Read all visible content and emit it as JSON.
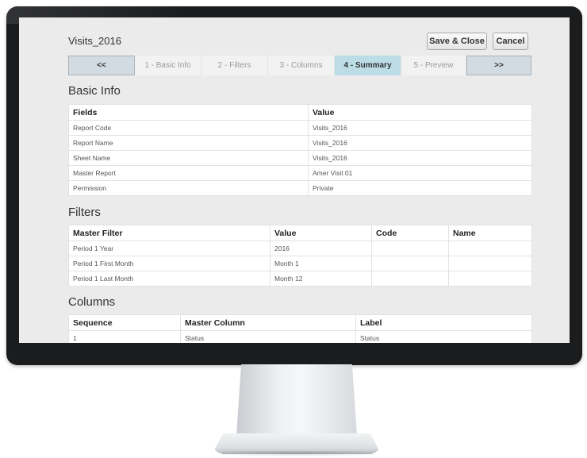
{
  "report": {
    "title": "Visits_2016",
    "save_close_label": "Save & Close",
    "cancel_label": "Cancel"
  },
  "wizard": {
    "prev_label": "<<",
    "next_label": ">>",
    "steps": [
      "1 - Basic Info",
      "2 - Filters",
      "3 - Columns",
      "4 - Summary",
      "5 - Preview"
    ],
    "active_step": "4 - Summary"
  },
  "basic_info": {
    "title": "Basic Info",
    "headers": [
      "Fields",
      "Value"
    ],
    "rows": [
      [
        "Report Code",
        "Visits_2016"
      ],
      [
        "Report Name",
        "Visits_2016"
      ],
      [
        "Sheet Name",
        "Visits_2016"
      ],
      [
        "Master Report",
        "Amer Visit 01"
      ],
      [
        "Permission",
        "Private"
      ]
    ]
  },
  "filters": {
    "title": "Filters",
    "headers": [
      "Master Filter",
      "Value",
      "Code",
      "Name"
    ],
    "rows": [
      [
        "Period 1 Year",
        "2016",
        "",
        ""
      ],
      [
        "Period 1 First Month",
        "Month 1",
        "",
        ""
      ],
      [
        "Period 1 Last Month",
        "Month 12",
        "",
        ""
      ]
    ]
  },
  "columns": {
    "title": "Columns",
    "headers": [
      "Sequence",
      "Master Column",
      "Label"
    ],
    "rows": [
      [
        "1",
        "Status",
        "Status"
      ]
    ]
  }
}
